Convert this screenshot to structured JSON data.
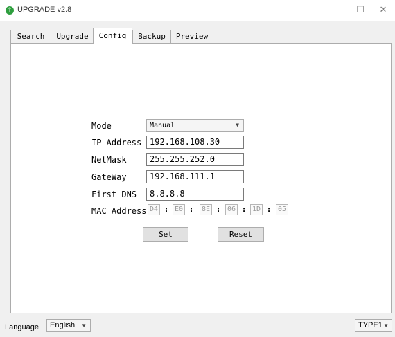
{
  "window": {
    "title": "UPGRADE v2.8",
    "minimize": "—",
    "maximize": "☐",
    "close": "✕"
  },
  "tabs": [
    "Search",
    "Upgrade",
    "Config",
    "Backup",
    "Preview"
  ],
  "active_tab": "Config",
  "config": {
    "mode_label": "Mode",
    "mode_value": "Manual",
    "ip_label": "IP Address",
    "ip_value": "192.168.108.30",
    "netmask_label": "NetMask",
    "netmask_value": "255.255.252.0",
    "gateway_label": "GateWay",
    "gateway_value": "192.168.111.1",
    "dns_label": "First DNS",
    "dns_value": "8.8.8.8",
    "mac_label": "MAC Address",
    "mac_octets": [
      "D4",
      "E0",
      "8E",
      "06",
      "1D",
      "05"
    ],
    "mac_separator": ":",
    "set_label": "Set",
    "reset_label": "Reset"
  },
  "footer": {
    "language_label": "Language",
    "language_value": "English",
    "type_value": "TYPE1"
  },
  "icons": {
    "app": "upgrade-arrow-icon",
    "dropdown": "chevron-down-icon"
  }
}
